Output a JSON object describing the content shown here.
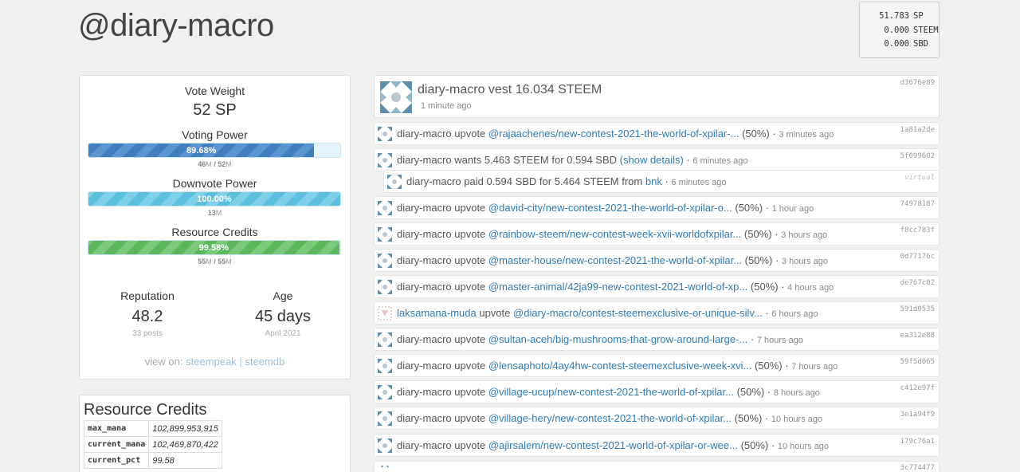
{
  "account": {
    "title": "@diary-macro"
  },
  "balances": [
    {
      "amount": "51.783",
      "currency": "SP"
    },
    {
      "amount": "0.000",
      "currency": "STEEM"
    },
    {
      "amount": "0.000",
      "currency": "SBD"
    }
  ],
  "stats": {
    "vote_weight_label": "Vote Weight",
    "vote_weight_value": "52 SP",
    "voting_power": {
      "label": "Voting Power",
      "percent_text": "89.68%",
      "fill_fraction": 0.8968,
      "sub_a": "46",
      "sub_a_unit": "M",
      "sub_sep": " / ",
      "sub_b": "52",
      "sub_b_unit": "M",
      "color": "#3f7fbf"
    },
    "downvote_power": {
      "label": "Downvote Power",
      "percent_text": "100.00%",
      "fill_fraction": 1.0,
      "sub_a": "13",
      "sub_a_unit": "M",
      "color": "#5bc0de"
    },
    "resource_credits": {
      "label": "Resource Credits",
      "percent_text": "99.58%",
      "fill_fraction": 0.9958,
      "sub_a": "55",
      "sub_a_unit": "M",
      "sub_sep": " / ",
      "sub_b": "55",
      "sub_b_unit": "M",
      "color": "#5cb85c"
    },
    "reputation": {
      "label": "Reputation",
      "value": "48.2",
      "sub": "33 posts"
    },
    "age": {
      "label": "Age",
      "value": "45 days",
      "sub": "April 2021"
    },
    "view_on": {
      "prefix": "view on:",
      "link1": "steempeak",
      "sep": "|",
      "link2": "steemdb"
    }
  },
  "rc": {
    "title": "Resource Credits",
    "rows": [
      {
        "key": "max_mana",
        "value": "102,899,953,915"
      },
      {
        "key": "current_mana",
        "value": "102,469,870,422"
      },
      {
        "key": "current_pct",
        "value": "99.58"
      }
    ]
  },
  "feed": {
    "top": {
      "text": "diary-macro vest 16.034 STEEM",
      "time": "1 minute ago",
      "hash": "d3676e89"
    },
    "ops": [
      {
        "actor": "diary-macro",
        "verb": "upvote",
        "link": "@rajaachenes/new-contest-2021-the-world-of-xpilar-...",
        "pct": "(50%)",
        "time": "3 minutes ago",
        "hash": "1a81a2de"
      },
      {
        "actor": "diary-macro",
        "verb": "wants 5.463 STEEM for 0.594 SBD",
        "link": "(show details)",
        "pct": "",
        "time": "6 minutes ago",
        "hash": "5f099602"
      },
      {
        "actor": "diary-macro",
        "verb": "paid 0.594 SBD for 5.464 STEEM from",
        "link": "bnk",
        "pct": "",
        "time": "6 minutes ago",
        "hash": "virtual"
      },
      {
        "actor": "diary-macro",
        "verb": "upvote",
        "link": "@david-city/new-contest-2021-the-world-of-xpilar-o...",
        "pct": "(50%)",
        "time": "1 hour ago",
        "hash": "74978187"
      },
      {
        "actor": "diary-macro",
        "verb": "upvote",
        "link": "@rainbow-steem/new-contest-week-xvii-worldofxpilar...",
        "pct": "(50%)",
        "time": "3 hours ago",
        "hash": "f8cc783f"
      },
      {
        "actor": "diary-macro",
        "verb": "upvote",
        "link": "@master-house/new-contest-2021-the-world-of-xpilar...",
        "pct": "(50%)",
        "time": "3 hours ago",
        "hash": "0d77176c"
      },
      {
        "actor": "diary-macro",
        "verb": "upvote",
        "link": "@master-animal/42ja99-new-contest-2021-world-of-xp...",
        "pct": "(50%)",
        "time": "4 hours ago",
        "hash": "de767c02"
      },
      {
        "actor": "laksamana-muda",
        "verb": "upvote",
        "link": "@diary-macro/contest-steemexclusive-or-unique-silv...",
        "pct": "",
        "time": "6 hours ago",
        "hash": "591d0535"
      },
      {
        "actor": "diary-macro",
        "verb": "upvote",
        "link": "@sultan-aceh/big-mushrooms-that-grow-around-large-...",
        "pct": "",
        "time": "7 hours ago",
        "hash": "ea312e88"
      },
      {
        "actor": "diary-macro",
        "verb": "upvote",
        "link": "@lensaphoto/4ay4hw-contest-steemexclusive-week-xvi...",
        "pct": "(50%)",
        "time": "7 hours ago",
        "hash": "59f5d065"
      },
      {
        "actor": "diary-macro",
        "verb": "upvote",
        "link": "@village-ucup/new-contest-2021-the-world-of-xpilar...",
        "pct": "(50%)",
        "time": "8 hours ago",
        "hash": "c412e97f"
      },
      {
        "actor": "diary-macro",
        "verb": "upvote",
        "link": "@village-hery/new-contest-2021-the-world-of-xpilar...",
        "pct": "(50%)",
        "time": "10 hours ago",
        "hash": "3e1a94f9"
      },
      {
        "actor": "diary-macro",
        "verb": "upvote",
        "link": "@ajirsalem/new-contest-2021-world-of-xpilar-or-wee...",
        "pct": "(50%)",
        "time": "10 hours ago",
        "hash": "179c76a1"
      }
    ],
    "partial_hash": "3c774477"
  }
}
